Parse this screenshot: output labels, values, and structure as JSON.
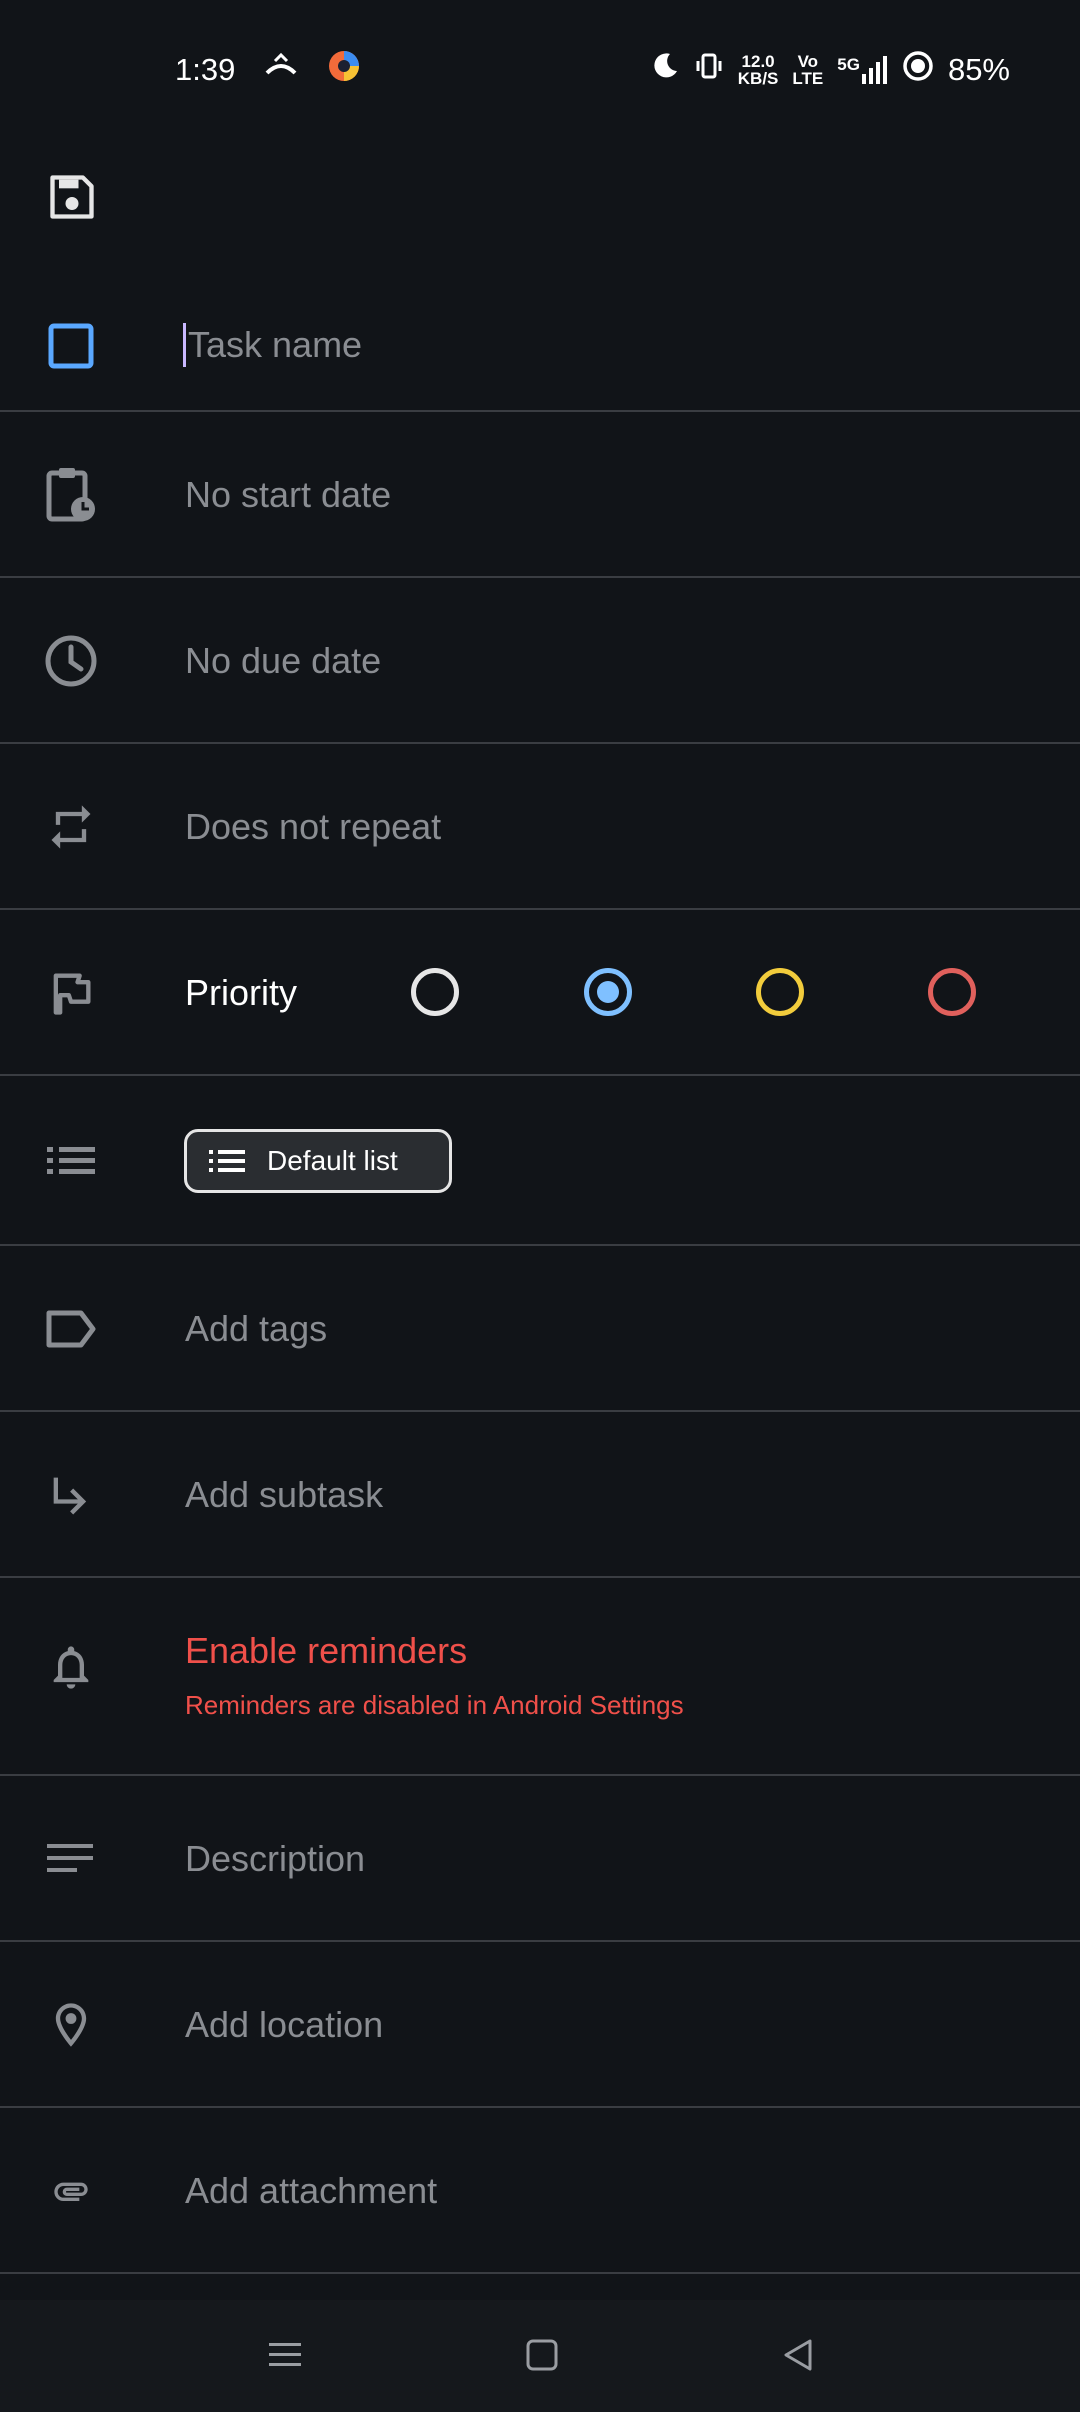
{
  "status_bar": {
    "time": "1:39",
    "net_speed_top": "12.0",
    "net_speed_bottom": "KB/S",
    "volte_top": "Vo",
    "volte_bottom": "LTE",
    "network": "5G",
    "battery": "85%",
    "icons": [
      "missed-call-icon",
      "app-notification-icon",
      "moon-icon",
      "vibrate-icon",
      "signal-icon",
      "battery-saver-icon"
    ]
  },
  "toolbar": {
    "save_icon": "save-icon"
  },
  "task": {
    "placeholder": "Task name",
    "checkbox_color": "#5aa8ff"
  },
  "rows": {
    "start_date": "No start date",
    "due_date": "No due date",
    "repeat": "Does not repeat",
    "tags": "Add tags",
    "subtask": "Add subtask",
    "description": "Description",
    "location": "Add location",
    "attachment": "Add attachment"
  },
  "priority": {
    "label": "Priority",
    "options": [
      {
        "name": "none",
        "color": "#e6e6e6",
        "selected": false
      },
      {
        "name": "low",
        "color": "#5aa8ff",
        "selected": true
      },
      {
        "name": "medium",
        "color": "#f2cc3c",
        "selected": false
      },
      {
        "name": "high",
        "color": "#e0605c",
        "selected": false
      }
    ]
  },
  "list": {
    "chip_label": "Default list"
  },
  "reminders": {
    "title": "Enable reminders",
    "subtitle": "Reminders are disabled in Android Settings",
    "color": "#f0504a"
  }
}
